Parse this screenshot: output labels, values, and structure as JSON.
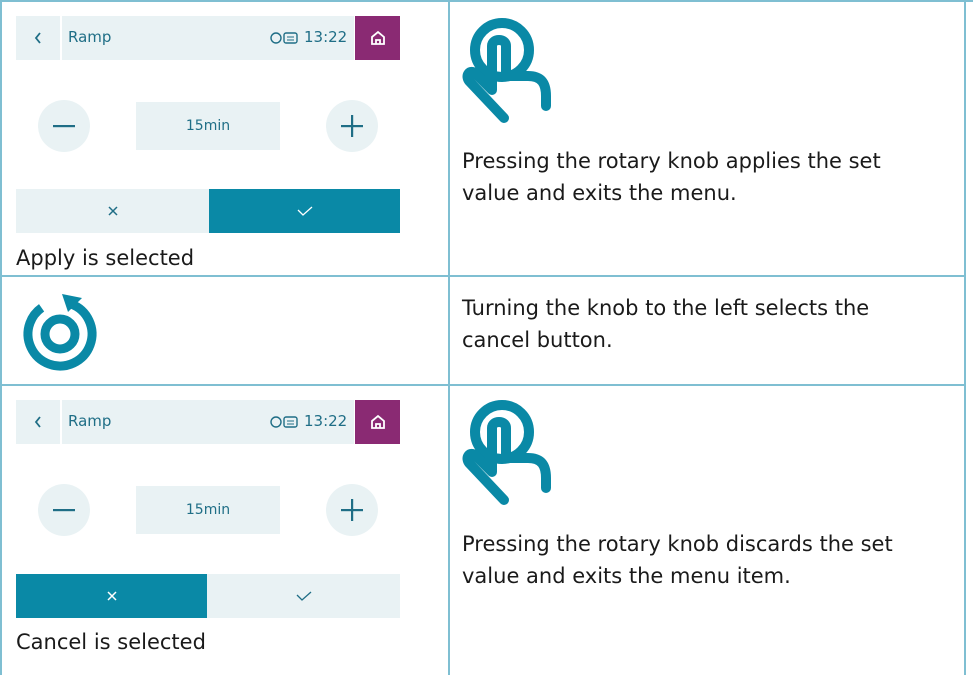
{
  "colors": {
    "accent": "#0a89a6",
    "panel": "#e9f2f4",
    "home": "#8a2a73",
    "text": "#1f6e86"
  },
  "screens": [
    {
      "title": "Ramp",
      "time": "13:22",
      "value": "15min",
      "selected": "apply",
      "caption": "Apply is selected"
    },
    {
      "title": "Ramp",
      "time": "13:22",
      "value": "15min",
      "selected": "cancel",
      "caption": "Cancel is selected"
    }
  ],
  "rows": [
    {
      "icon": "press-hand-icon",
      "text": "Pressing the rotary knob applies the set value and exits the menu."
    },
    {
      "icon": "rotate-left-icon",
      "text": "Turning the knob to the left selects the cancel button."
    },
    {
      "icon": "press-hand-icon",
      "text": "Pressing the rotary knob discards the set value and exits the menu item."
    }
  ]
}
